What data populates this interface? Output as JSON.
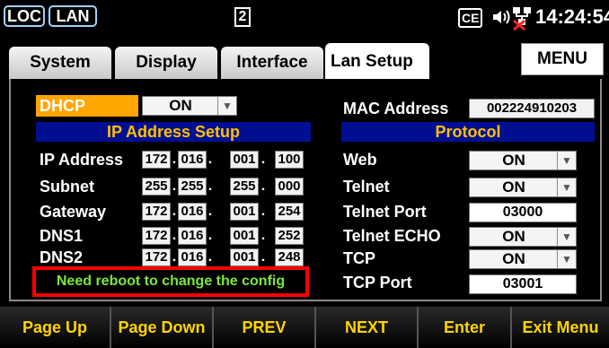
{
  "status": {
    "loc": "LOC",
    "lan": "LAN",
    "page_indicator": "2",
    "ce_icon": "CE",
    "time": "14:24:54"
  },
  "tabs": [
    {
      "label": "System"
    },
    {
      "label": "Display"
    },
    {
      "label": "Interface"
    },
    {
      "label": "Lan Setup",
      "active": true
    }
  ],
  "menu_button": "MENU",
  "left": {
    "dhcp_label": "DHCP",
    "dhcp_value": "ON",
    "section_header": "IP Address Setup",
    "rows": [
      {
        "label": "IP Address",
        "octets": [
          "172",
          "016",
          "001",
          "100"
        ]
      },
      {
        "label": "Subnet",
        "octets": [
          "255",
          "255",
          "255",
          "000"
        ]
      },
      {
        "label": "Gateway",
        "octets": [
          "172",
          "016",
          "001",
          "254"
        ]
      },
      {
        "label": "DNS1",
        "octets": [
          "172",
          "016",
          "001",
          "252"
        ]
      },
      {
        "label": "DNS2",
        "octets": [
          "172",
          "016",
          "001",
          "248"
        ]
      }
    ],
    "reboot_message": "Need reboot to change the config"
  },
  "right": {
    "mac_label": "MAC Address",
    "mac_value": "002224910203",
    "section_header": "Protocol",
    "web_label": "Web",
    "web_value": "ON",
    "telnet_label": "Telnet",
    "telnet_value": "ON",
    "telnet_port_label": "Telnet Port",
    "telnet_port_value": "03000",
    "telnet_echo_label": "Telnet ECHO",
    "telnet_echo_value": "ON",
    "tcp_label": "TCP",
    "tcp_value": "ON",
    "tcp_port_label": "TCP Port",
    "tcp_port_value": "03001"
  },
  "softkeys": [
    "Page Up",
    "Page Down",
    "PREV",
    "NEXT",
    "Enter",
    "Exit Menu"
  ],
  "colors": {
    "dhcp_highlight": "#ffa500",
    "header_bg": "#000f92",
    "header_text": "#ffc000",
    "softkey_text": "#ffd400",
    "warning_border": "#ff0000",
    "warning_text": "#7ce63c"
  }
}
